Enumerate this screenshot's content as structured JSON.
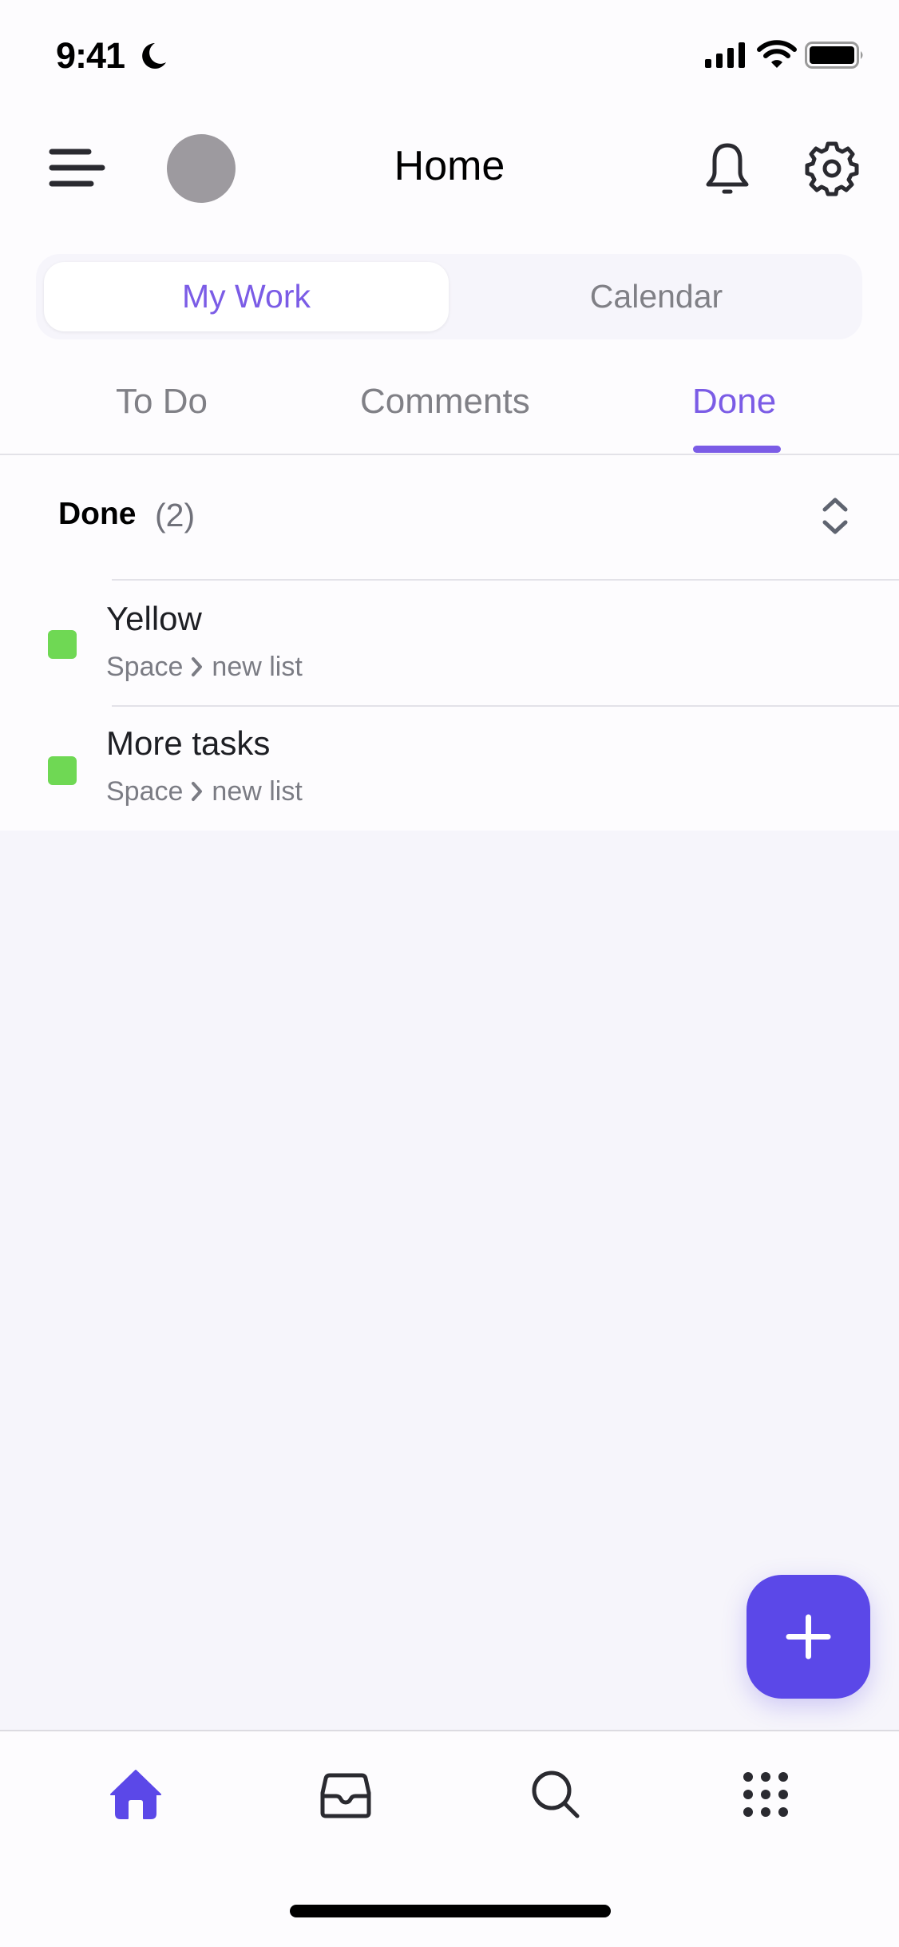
{
  "status_bar": {
    "time": "9:41",
    "focus_icon": "moon-icon",
    "signal_icon": "cellular-signal-icon",
    "wifi_icon": "wifi-icon",
    "battery_icon": "battery-icon"
  },
  "header": {
    "title": "Home",
    "menu_icon": "hamburger-menu-icon",
    "notifications_icon": "bell-icon",
    "settings_icon": "gear-icon"
  },
  "segmented_control": {
    "options": [
      {
        "label": "My Work",
        "selected": true
      },
      {
        "label": "Calendar",
        "selected": false
      }
    ]
  },
  "sub_tabs": [
    {
      "label": "To Do",
      "selected": false
    },
    {
      "label": "Comments",
      "selected": false
    },
    {
      "label": "Done",
      "selected": true
    }
  ],
  "section": {
    "title": "Done",
    "count": "(2)",
    "sort_icon": "chevron-up-down-icon"
  },
  "tasks": [
    {
      "title": "Yellow",
      "space": "Space",
      "list": "new list",
      "status_color": "#6fd854"
    },
    {
      "title": "More tasks",
      "space": "Space",
      "list": "new list",
      "status_color": "#6fd854"
    }
  ],
  "fab": {
    "icon": "plus-icon",
    "color": "#5b48e8"
  },
  "bottom_nav": [
    {
      "name": "home",
      "icon": "home-icon",
      "active": true
    },
    {
      "name": "inbox",
      "icon": "inbox-icon",
      "active": false
    },
    {
      "name": "search",
      "icon": "search-icon",
      "active": false
    },
    {
      "name": "more",
      "icon": "apps-grid-icon",
      "active": false
    }
  ],
  "colors": {
    "accent": "#7b5ce6",
    "fab": "#5b48e8",
    "background": "#f6f5fb",
    "done_status": "#6fd854"
  }
}
